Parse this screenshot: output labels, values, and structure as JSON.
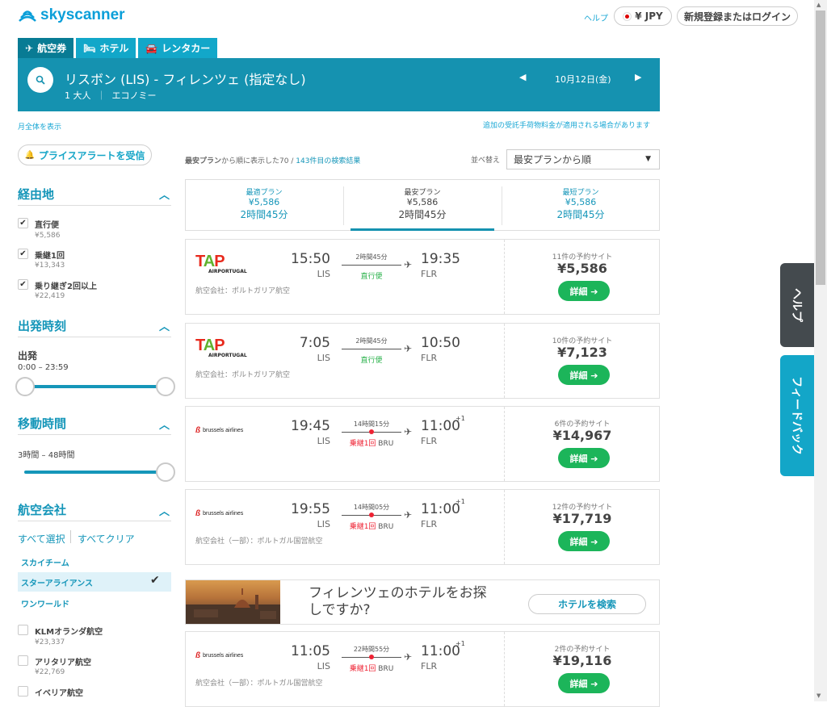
{
  "brand": {
    "name": "skyscanner"
  },
  "header": {
    "help": "ヘルプ",
    "currency": "¥ JPY",
    "login": "新規登録またはログイン"
  },
  "tabs": [
    {
      "label": "航空券",
      "icon": "plane-icon"
    },
    {
      "label": "ホテル",
      "icon": "bed-icon"
    },
    {
      "label": "レンタカー",
      "icon": "car-icon"
    }
  ],
  "search": {
    "route": "リスボン (LIS) - フィレンツェ (指定なし)",
    "passengers": "1 大人",
    "cabin": "エコノミー",
    "date": "10月12日(金)"
  },
  "links": {
    "month_view": "月全体を表示",
    "baggage_note": "追加の受託手荷物料金が適用される場合があります"
  },
  "price_alert": "プライスアラートを受信",
  "filters": {
    "stops": {
      "title": "経由地",
      "items": [
        {
          "label": "直行便",
          "price": "¥5,586",
          "checked": true
        },
        {
          "label": "乗継1回",
          "price": "¥13,343",
          "checked": true
        },
        {
          "label": "乗り継ぎ2回以上",
          "price": "¥22,419",
          "checked": true
        }
      ]
    },
    "departure": {
      "title": "出発時刻",
      "label": "出発",
      "range": "0:00 – 23:59"
    },
    "duration": {
      "title": "移動時間",
      "range": "3時間 – 48時間"
    },
    "airlines": {
      "title": "航空会社",
      "select_all": "すべて選択",
      "clear_all": "すべてクリア",
      "alliances": [
        "スカイチーム",
        "スターアライアンス",
        "ワンワールド"
      ],
      "selected_alliance": "スターアライアンス",
      "items": [
        {
          "label": "KLMオランダ航空",
          "price": "¥23,337"
        },
        {
          "label": "アリタリア航空",
          "price": "¥22,769"
        },
        {
          "label": "イベリア航空",
          "price": ""
        }
      ]
    }
  },
  "results": {
    "meta_sort": "最安プラン",
    "meta_prefix": "から順に表示した",
    "meta_shown": "70",
    "meta_sep": " / ",
    "meta_total": "143件目の検索結果",
    "sort_label": "並べ替え",
    "sort_value": "最安プランから順"
  },
  "sort_tabs": [
    {
      "title": "最適プラン",
      "price": "¥5,586",
      "duration": "2時間45分"
    },
    {
      "title": "最安プラン",
      "price": "¥5,586",
      "duration": "2時間45分"
    },
    {
      "title": "最短プラン",
      "price": "¥5,586",
      "duration": "2時間45分"
    }
  ],
  "flights": [
    {
      "airline_logo": "TAP",
      "logo_sub": "AIRPORTUGAL",
      "dep_time": "15:50",
      "dep_airport": "LIS",
      "duration": "2時間45分",
      "stops": "直行便",
      "stop_via": "",
      "arr_time": "19:35",
      "arr_airport": "FLR",
      "plus": "",
      "airline": "航空会社：ポルトガリア航空",
      "sites": "11件の予約サイト",
      "price": "¥5,586",
      "button": "詳細 ➔"
    },
    {
      "airline_logo": "TAP",
      "logo_sub": "AIRPORTUGAL",
      "dep_time": "7:05",
      "dep_airport": "LIS",
      "duration": "2時間45分",
      "stops": "直行便",
      "stop_via": "",
      "arr_time": "10:50",
      "arr_airport": "FLR",
      "plus": "",
      "airline": "航空会社：ポルトガリア航空",
      "sites": "10件の予約サイト",
      "price": "¥7,123",
      "button": "詳細 ➔"
    },
    {
      "airline_logo": "brussels airlines",
      "logo_sub": "",
      "dep_time": "19:45",
      "dep_airport": "LIS",
      "duration": "14時間15分",
      "stops": "乗継1回",
      "stop_via": "BRU",
      "arr_time": "11:00",
      "arr_airport": "FLR",
      "plus": "+1",
      "airline": "",
      "sites": "6件の予約サイト",
      "price": "¥14,967",
      "button": "詳細 ➔"
    },
    {
      "airline_logo": "brussels airlines",
      "logo_sub": "",
      "dep_time": "19:55",
      "dep_airport": "LIS",
      "duration": "14時間05分",
      "stops": "乗継1回",
      "stop_via": "BRU",
      "arr_time": "11:00",
      "arr_airport": "FLR",
      "plus": "+1",
      "airline": "航空会社（一部）：ポルトガル国営航空",
      "sites": "12件の予約サイト",
      "price": "¥17,719",
      "button": "詳細 ➔"
    },
    {
      "airline_logo": "brussels airlines",
      "logo_sub": "",
      "dep_time": "11:05",
      "dep_airport": "LIS",
      "duration": "22時間55分",
      "stops": "乗継1回",
      "stop_via": "BRU",
      "arr_time": "11:00",
      "arr_airport": "FLR",
      "plus": "+1",
      "airline": "航空会社（一部）：ポルトガル国営航空",
      "sites": "2件の予約サイト",
      "price": "¥19,116",
      "button": "詳細 ➔"
    }
  ],
  "hotel_promo": {
    "text": "フィレンツェのホテルをお探しですか?",
    "button": "ホテルを検索"
  },
  "side_tabs": {
    "help": "ヘルプ",
    "feedback": "フィードバック"
  },
  "colors": {
    "brand": "#0b9fd9",
    "banner": "#1592b0",
    "book": "#1cb55a",
    "stop": "#e23"
  }
}
